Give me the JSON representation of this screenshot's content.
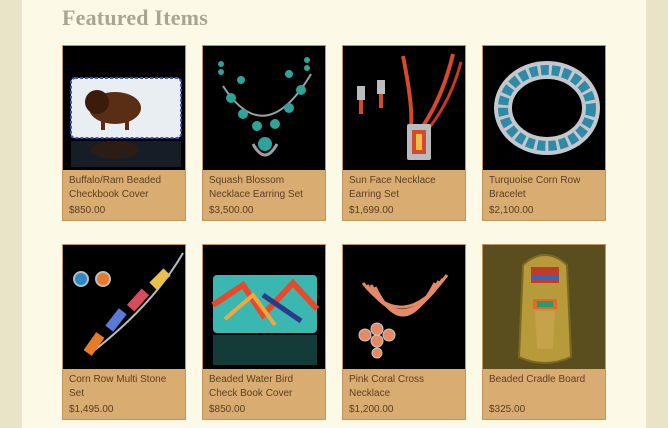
{
  "section": {
    "title": "Featured Items"
  },
  "products": [
    {
      "name": "Buffalo/Ram Beaded Checkbook Cover",
      "price": "$850.00",
      "image": "buffalo-beaded-checkbook"
    },
    {
      "name": "Squash Blossom Necklace Earring Set",
      "price": "$3,500.00",
      "image": "turquoise-squash-blossom"
    },
    {
      "name": "Sun Face Necklace Earring Set",
      "price": "$1,699.00",
      "image": "coral-sun-face-necklace"
    },
    {
      "name": "Turquoise Corn Row Bracelet",
      "price": "$2,100.00",
      "image": "turquoise-cuff-bracelet"
    },
    {
      "name": "Corn Row Multi Stone Set",
      "price": "$1,495.00",
      "image": "multi-stone-necklace"
    },
    {
      "name": "Beaded Water Bird Check Book Cover",
      "price": "$850.00",
      "image": "water-bird-beaded-cover"
    },
    {
      "name": "Pink Coral Cross Necklace",
      "price": "$1,200.00",
      "image": "pink-coral-cross"
    },
    {
      "name": "Beaded Cradle Board",
      "price": "$325.00",
      "image": "cradle-board"
    }
  ],
  "colors": {
    "page_background": "#e9e3c8",
    "panel_background": "#fcf9e6",
    "card_background": "#d9ac72",
    "card_text": "#5a3f22",
    "title_text": "#a8a692"
  }
}
